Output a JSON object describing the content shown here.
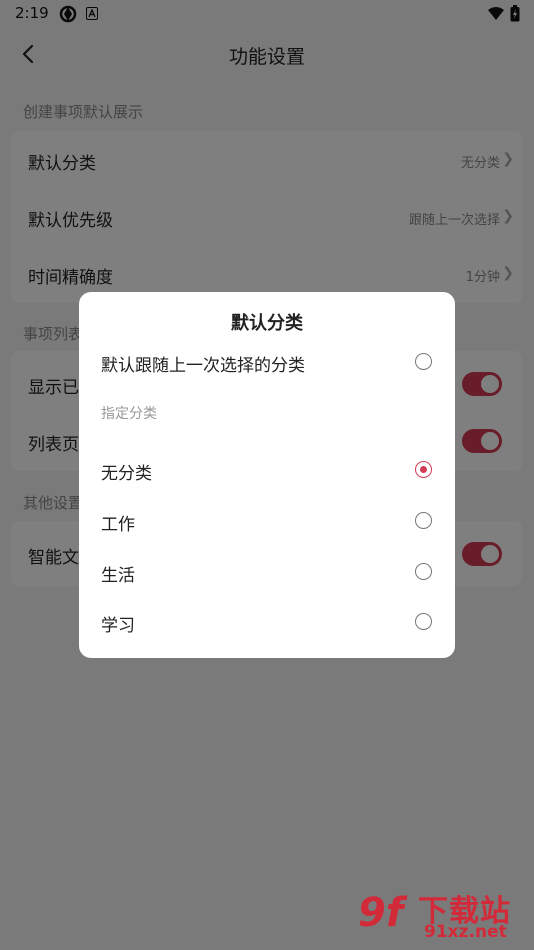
{
  "status": {
    "time": "2:19"
  },
  "header": {
    "title": "功能设置"
  },
  "sections": [
    {
      "label": "创建事项默认展示",
      "rows": [
        {
          "label": "默认分类",
          "value": "无分类"
        },
        {
          "label": "默认优先级",
          "value": "跟随上一次选择"
        },
        {
          "label": "时间精确度",
          "value": "1分钟"
        }
      ]
    },
    {
      "label": "事项列表",
      "rows": [
        {
          "label": "显示已",
          "toggle": true
        },
        {
          "label": "列表页",
          "toggle": true
        }
      ]
    },
    {
      "label": "其他设置",
      "rows": [
        {
          "label": "智能文",
          "toggle": true
        }
      ]
    }
  ],
  "dialog": {
    "title": "默认分类",
    "follow_option": "默认跟随上一次选择的分类",
    "subheader": "指定分类",
    "options": [
      {
        "label": "无分类",
        "selected": true
      },
      {
        "label": "工作",
        "selected": false
      },
      {
        "label": "生活",
        "selected": false
      },
      {
        "label": "学习",
        "selected": false
      }
    ]
  },
  "watermark": {
    "brand": "下载站",
    "url": "91xz.net"
  },
  "colors": {
    "accent": "#d23b55",
    "background": "#f5f5f7"
  }
}
